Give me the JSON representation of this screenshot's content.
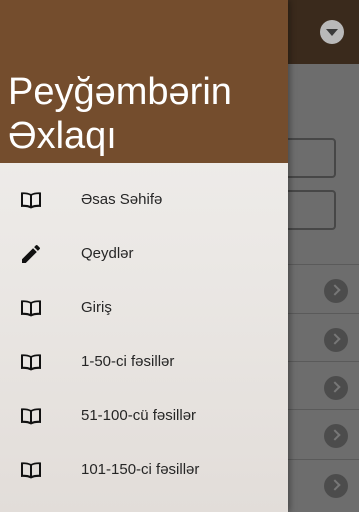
{
  "drawer": {
    "title": "Peyğəmbərin\nƏxlaqı",
    "header_color": "#744d2d",
    "items": [
      {
        "label": "Əsas Səhifə",
        "icon": "book-icon"
      },
      {
        "label": "Qeydlər",
        "icon": "pencil-icon"
      },
      {
        "label": "Giriş",
        "icon": "book-icon"
      },
      {
        "label": "1-50-ci fəsillər",
        "icon": "book-icon"
      },
      {
        "label": "51-100-cü fəsillər",
        "icon": "book-icon"
      },
      {
        "label": "101-150-ci fəsillər",
        "icon": "book-icon"
      }
    ]
  },
  "background": {
    "dropdown_icon": "chevron-down-icon",
    "row_icon": "chevron-right-icon"
  }
}
